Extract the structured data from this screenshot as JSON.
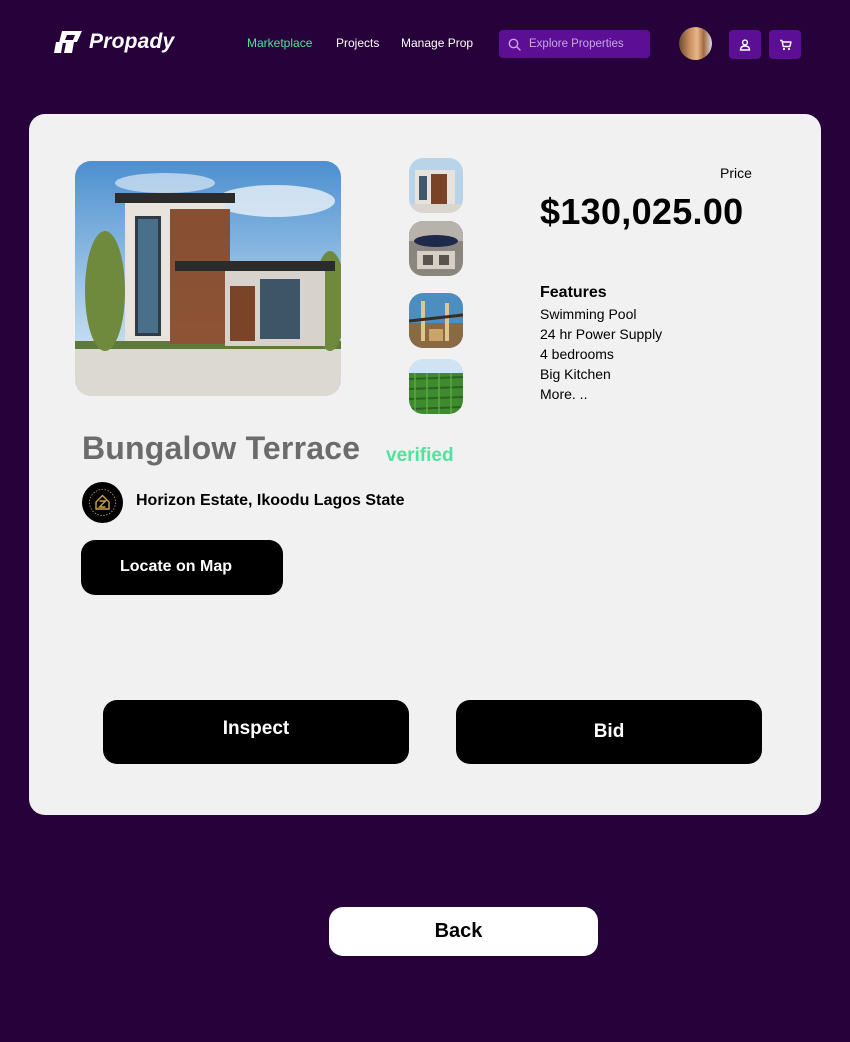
{
  "header": {
    "logo_text": "Propady",
    "nav": {
      "marketplace": "Marketplace",
      "projects": "Projects",
      "manage_prop": "Manage Prop"
    },
    "search": {
      "placeholder": "Explore Properties"
    },
    "icons": [
      "logo-icon",
      "search-icon",
      "user-icon",
      "cart-icon"
    ]
  },
  "property": {
    "title": "Bungalow Terrace",
    "status": "verified",
    "location": "Horizon Estate, Ikoodu Lagos State",
    "price_label": "Price",
    "price": "$130,025.00",
    "features_title": "Features",
    "features": [
      "Swimming Pool",
      "24 hr Power Supply",
      "4 bedrooms",
      "Big Kitchen",
      "More. .."
    ]
  },
  "actions": {
    "locate": "Locate on Map",
    "inspect": "Inspect",
    "bid": "Bid",
    "back": "Back"
  },
  "colors": {
    "background": "#27013a",
    "accent": "#5c0e95",
    "verified": "#4fe39b",
    "card": "#f1f1f1"
  }
}
